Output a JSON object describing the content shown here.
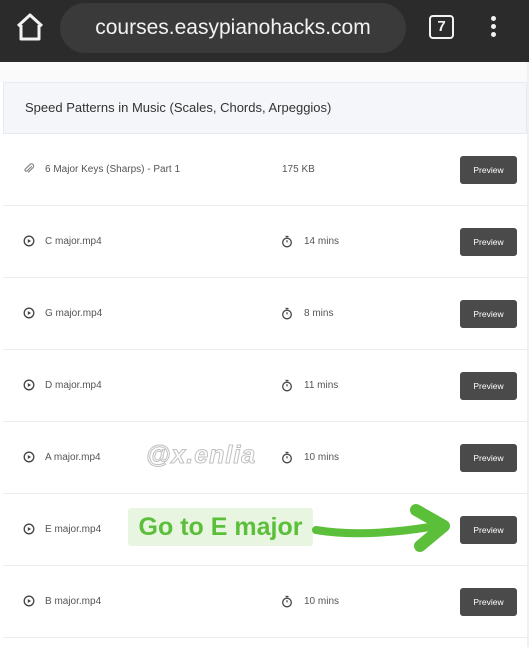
{
  "browser": {
    "url": "courses.easypianohacks.com",
    "tab_count": "7",
    "home_icon": "home-icon",
    "menu_icon": "more-vertical-icon"
  },
  "section": {
    "title": "Speed Patterns in Music (Scales, Chords, Arpeggios)"
  },
  "lessons": [
    {
      "title": "6 Major Keys (Sharps) - Part 1",
      "meta": "175 KB",
      "type": "attachment",
      "preview_label": "Preview"
    },
    {
      "title": "C major.mp4",
      "meta": "14 mins",
      "type": "video",
      "preview_label": "Preview"
    },
    {
      "title": "G major.mp4",
      "meta": "8 mins",
      "type": "video",
      "preview_label": "Preview"
    },
    {
      "title": "D major.mp4",
      "meta": "11 mins",
      "type": "video",
      "preview_label": "Preview"
    },
    {
      "title": "A major.mp4",
      "meta": "10 mins",
      "type": "video",
      "preview_label": "Preview"
    },
    {
      "title": "E major.mp4",
      "meta": "",
      "type": "video",
      "preview_label": "Preview"
    },
    {
      "title": "B major.mp4",
      "meta": "10 mins",
      "type": "video",
      "preview_label": "Preview"
    }
  ],
  "overlay": {
    "watermark": "@x.enlia",
    "annotation": "Go to E major",
    "annotation_color": "#5bbf3a"
  }
}
